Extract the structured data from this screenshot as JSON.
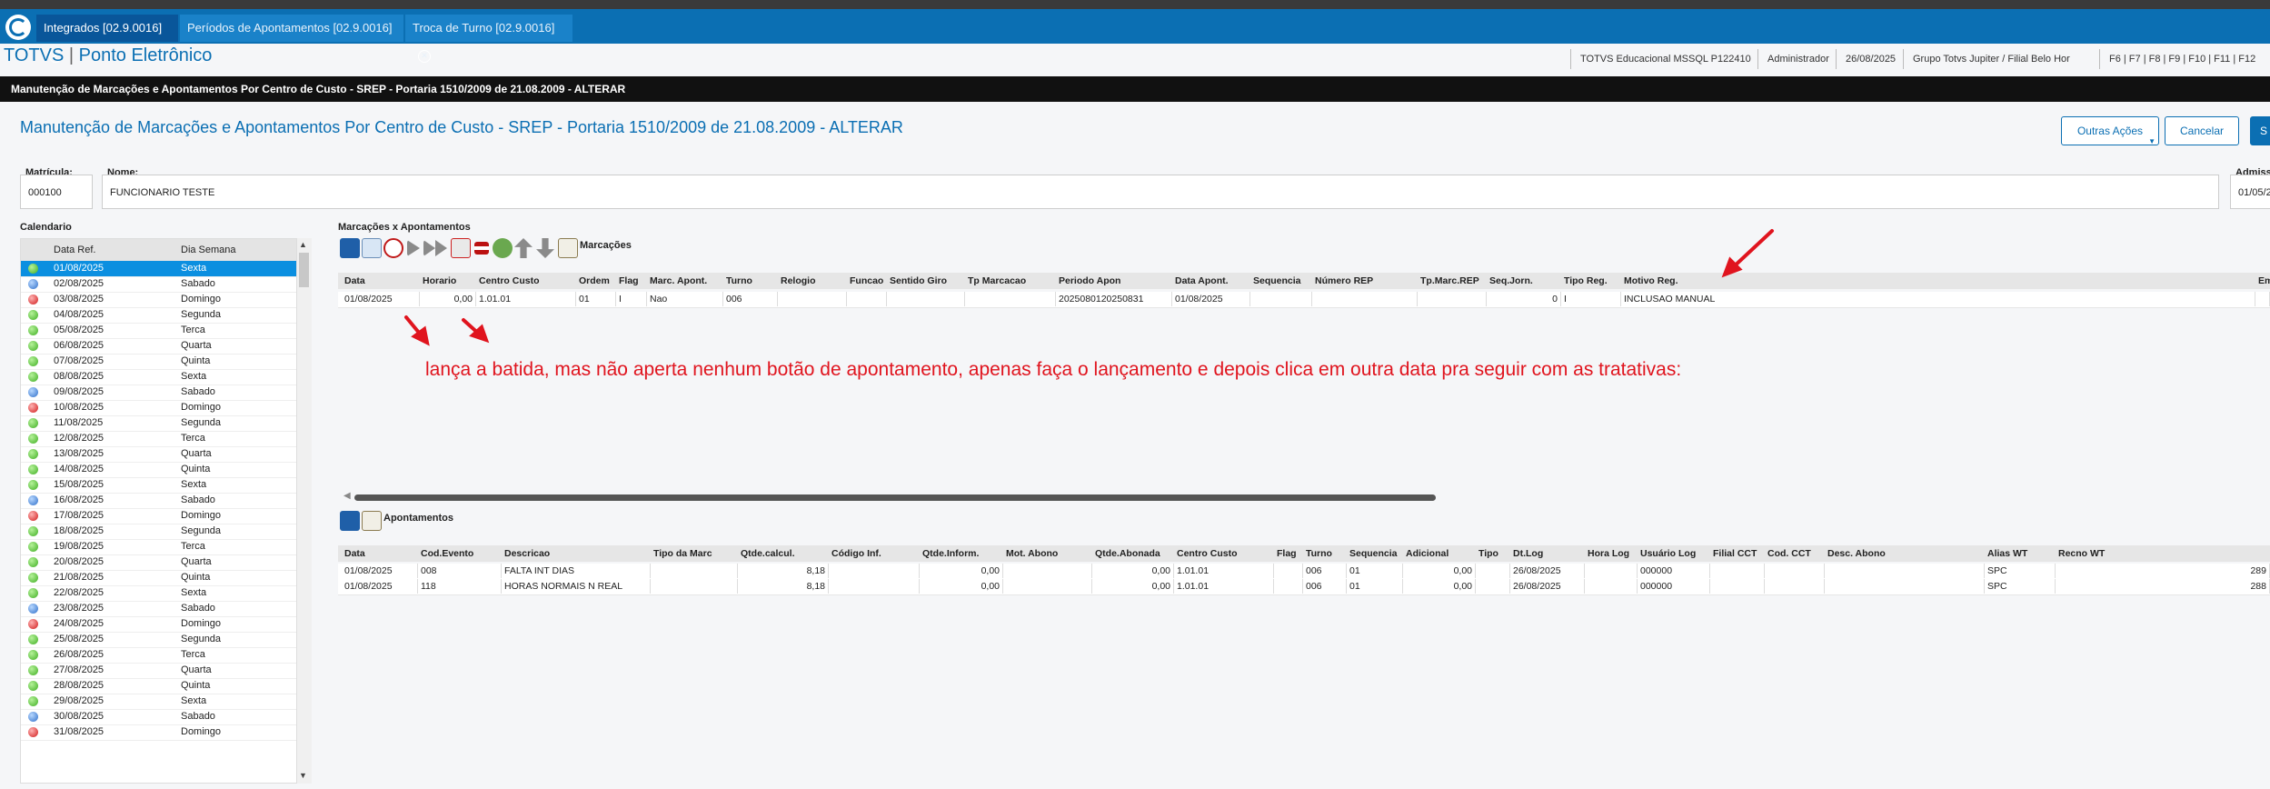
{
  "tabs": [
    {
      "label": "Integrados [02.9.0016]",
      "active": true
    },
    {
      "label": "Períodos de Apontamentos [02.9.0016]",
      "active": false
    },
    {
      "label": "Troca de Turno [02.9.0016]",
      "active": false
    }
  ],
  "app": {
    "brand": "TOTVS",
    "separator": "|",
    "module": "Ponto Eletrônico",
    "info": [
      "TOTVS Educacional MSSQL P122410",
      "Administrador",
      "26/08/2025",
      "Grupo Totvs Jupiter / Filial Belo Hor",
      "F6 | F7 | F8 | F9 | F10 | F11 | F12"
    ]
  },
  "form": {
    "bar_title": "Manutenção de Marcações e Apontamentos Por Centro de Custo - SREP - Portaria 1510/2009 de 21.08.2009 - ALTERAR",
    "title": "Manutenção de Marcações e Apontamentos Por Centro de Custo - SREP - Portaria 1510/2009 de 21.08.2009 - ALTERAR",
    "buttons": {
      "outras": "Outras Ações",
      "cancelar": "Cancelar",
      "salvar": "S"
    },
    "matricula_label": "Matrícula:",
    "matricula": "000100",
    "nome_label": "Nome:",
    "nome": "FUNCIONARIO TESTE",
    "admissao_label": "Admiss",
    "admissao": "01/05/2"
  },
  "calendar": {
    "label": "Calendario",
    "headers": [
      "Data Ref.",
      "Dia Semana"
    ],
    "rows": [
      {
        "date": "01/08/2025",
        "day": "Sexta",
        "status": "green",
        "selected": true
      },
      {
        "date": "02/08/2025",
        "day": "Sabado",
        "status": "blue"
      },
      {
        "date": "03/08/2025",
        "day": "Domingo",
        "status": "red"
      },
      {
        "date": "04/08/2025",
        "day": "Segunda",
        "status": "green"
      },
      {
        "date": "05/08/2025",
        "day": "Terca",
        "status": "green"
      },
      {
        "date": "06/08/2025",
        "day": "Quarta",
        "status": "green"
      },
      {
        "date": "07/08/2025",
        "day": "Quinta",
        "status": "green"
      },
      {
        "date": "08/08/2025",
        "day": "Sexta",
        "status": "green"
      },
      {
        "date": "09/08/2025",
        "day": "Sabado",
        "status": "blue"
      },
      {
        "date": "10/08/2025",
        "day": "Domingo",
        "status": "red"
      },
      {
        "date": "11/08/2025",
        "day": "Segunda",
        "status": "green"
      },
      {
        "date": "12/08/2025",
        "day": "Terca",
        "status": "green"
      },
      {
        "date": "13/08/2025",
        "day": "Quarta",
        "status": "green"
      },
      {
        "date": "14/08/2025",
        "day": "Quinta",
        "status": "green"
      },
      {
        "date": "15/08/2025",
        "day": "Sexta",
        "status": "green"
      },
      {
        "date": "16/08/2025",
        "day": "Sabado",
        "status": "blue"
      },
      {
        "date": "17/08/2025",
        "day": "Domingo",
        "status": "red"
      },
      {
        "date": "18/08/2025",
        "day": "Segunda",
        "status": "green"
      },
      {
        "date": "19/08/2025",
        "day": "Terca",
        "status": "green"
      },
      {
        "date": "20/08/2025",
        "day": "Quarta",
        "status": "green"
      },
      {
        "date": "21/08/2025",
        "day": "Quinta",
        "status": "green"
      },
      {
        "date": "22/08/2025",
        "day": "Sexta",
        "status": "green"
      },
      {
        "date": "23/08/2025",
        "day": "Sabado",
        "status": "blue"
      },
      {
        "date": "24/08/2025",
        "day": "Domingo",
        "status": "red"
      },
      {
        "date": "25/08/2025",
        "day": "Segunda",
        "status": "green"
      },
      {
        "date": "26/08/2025",
        "day": "Terca",
        "status": "green"
      },
      {
        "date": "27/08/2025",
        "day": "Quarta",
        "status": "green"
      },
      {
        "date": "28/08/2025",
        "day": "Quinta",
        "status": "green"
      },
      {
        "date": "29/08/2025",
        "day": "Sexta",
        "status": "green"
      },
      {
        "date": "30/08/2025",
        "day": "Sabado",
        "status": "blue"
      },
      {
        "date": "31/08/2025",
        "day": "Domingo",
        "status": "red"
      }
    ]
  },
  "marcacoes": {
    "section_label": "Marcações x Apontamentos",
    "toolbar_label": "Marcações",
    "headers": [
      "Data",
      "Horario",
      "Centro Custo",
      "Ordem",
      "Flag",
      "Marc. Apont.",
      "Turno",
      "Relogio",
      "Funcao",
      "Sentido Giro",
      "Tp Marcacao",
      "Periodo Apon",
      "Data Apont.",
      "Sequencia",
      "Número REP",
      "Tp.Marc.REP",
      "Seq.Jorn.",
      "Tipo Reg.",
      "Motivo Reg.",
      "Em"
    ],
    "rows": [
      [
        "01/08/2025",
        "0,00",
        "1.01.01",
        "01",
        "I",
        "Nao",
        "006",
        "",
        "",
        "",
        "",
        "2025080120250831",
        "01/08/2025",
        "",
        "",
        "",
        "0",
        "I",
        "INCLUSAO MANUAL",
        ""
      ]
    ]
  },
  "annotation": "lança a batida, mas não aperta nenhum botão de apontamento, apenas faça o lançamento e depois clica em outra data pra seguir com as tratativas:",
  "apontamentos": {
    "toolbar_label": "Apontamentos",
    "headers": [
      "Data",
      "Cod.Evento",
      "Descricao",
      "Tipo da Marc",
      "Qtde.calcul.",
      "Código Inf.",
      "Qtde.Inform.",
      "Mot. Abono",
      "Qtde.Abonada",
      "Centro Custo",
      "Flag",
      "Turno",
      "Sequencia",
      "Adicional",
      "Tipo",
      "Dt.Log",
      "Hora Log",
      "Usuário Log",
      "Filial CCT",
      "Cod. CCT",
      "Desc. Abono",
      "Alias WT",
      "Recno WT"
    ],
    "rows": [
      [
        "01/08/2025",
        "008",
        "FALTA INT DIAS",
        "",
        "8,18",
        "",
        "0,00",
        "",
        "0,00",
        "1.01.01",
        "",
        "006",
        "01",
        "0,00",
        "",
        "26/08/2025",
        "",
        "000000",
        "",
        "",
        "",
        "SPC",
        "289"
      ],
      [
        "01/08/2025",
        "118",
        "HORAS NORMAIS N REAL",
        "",
        "8,18",
        "",
        "0,00",
        "",
        "0,00",
        "1.01.01",
        "",
        "006",
        "01",
        "0,00",
        "",
        "26/08/2025",
        "",
        "000000",
        "",
        "",
        "",
        "SPC",
        "288"
      ]
    ]
  }
}
